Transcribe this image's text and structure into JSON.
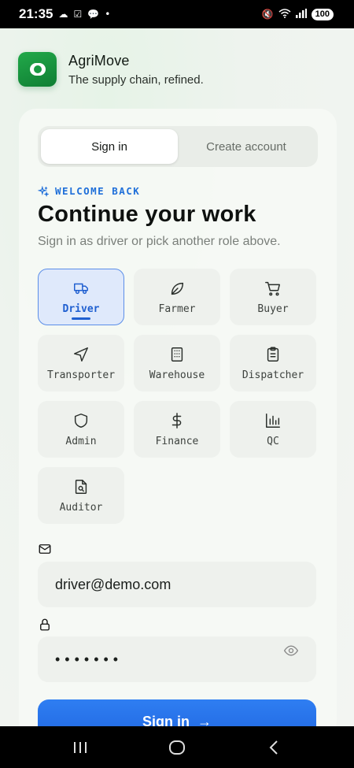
{
  "status_bar": {
    "time": "21:35",
    "battery": "100"
  },
  "brand": {
    "name": "AgriMove",
    "tagline": "The supply chain, refined."
  },
  "tabs": [
    {
      "label": "Sign in",
      "active": true
    },
    {
      "label": "Create account",
      "active": false
    }
  ],
  "welcome": "WELCOME BACK",
  "title": "Continue your work",
  "subtitle": "Sign in as driver or pick another role above.",
  "roles": [
    {
      "label": "Driver",
      "icon": "truck-icon",
      "active": true
    },
    {
      "label": "Farmer",
      "icon": "leaf-icon",
      "active": false
    },
    {
      "label": "Buyer",
      "icon": "cart-icon",
      "active": false
    },
    {
      "label": "Transporter",
      "icon": "navigation-icon",
      "active": false
    },
    {
      "label": "Warehouse",
      "icon": "building-icon",
      "active": false
    },
    {
      "label": "Dispatcher",
      "icon": "clipboard-icon",
      "active": false
    },
    {
      "label": "Admin",
      "icon": "shield-icon",
      "active": false
    },
    {
      "label": "Finance",
      "icon": "dollar-icon",
      "active": false
    },
    {
      "label": "QC",
      "icon": "bar-chart-icon",
      "active": false
    },
    {
      "label": "Auditor",
      "icon": "file-search-icon",
      "active": false
    }
  ],
  "form": {
    "email_value": "driver@demo.com",
    "password_value": "•••••••",
    "submit_label": "Sign in",
    "submit_arrow": "→"
  },
  "colors": {
    "accent": "#1f66e0",
    "brand_green": "#1a9a43"
  }
}
